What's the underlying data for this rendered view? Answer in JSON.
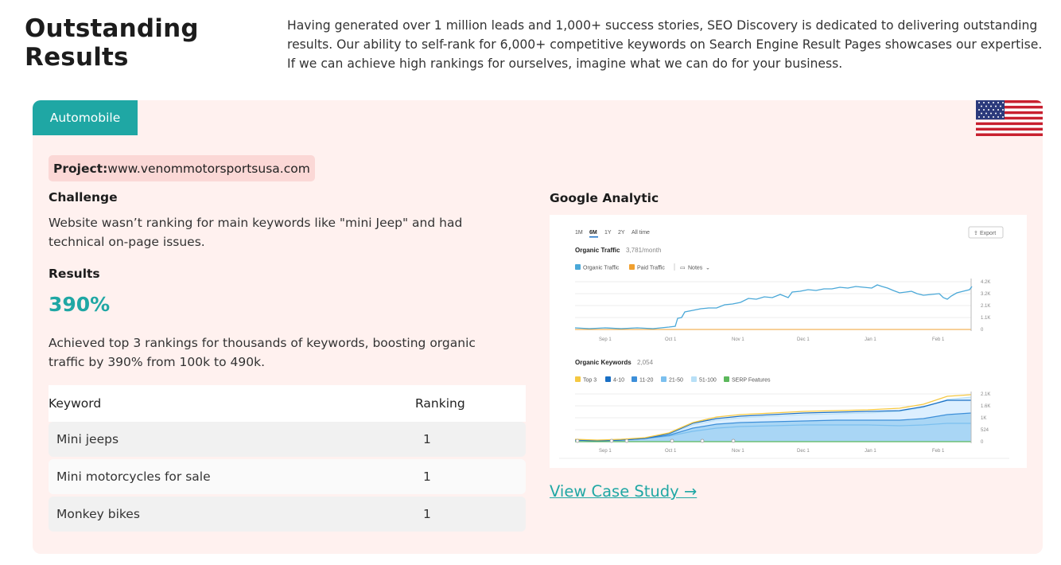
{
  "section": {
    "title_line1": "Outstanding",
    "title_line2": "Results",
    "intro": "Having generated over 1 million leads and 1,000+ success stories, SEO Discovery is dedicated to delivering outstanding results. Our ability to self-rank for 6,000+ competitive keywords on Search Engine Result Pages showcases our expertise. If we can achieve high rankings for ourselves, imagine what we can do for your business."
  },
  "card": {
    "tab_label": "Automobile",
    "flag_icon": "us-flag-icon",
    "project_label": "Project:",
    "project_url": "www.venommotorsportsusa.com",
    "challenge_title": "Challenge",
    "challenge_text": "Website wasn’t ranking for main keywords like \"mini Jeep\" and had technical on-page issues.",
    "results_title": "Results",
    "results_big": "390%",
    "results_text": "Achieved top 3 rankings for thousands of keywords, boosting organic traffic by 390% from 100k to 490k.",
    "table": {
      "headers": [
        "Keyword",
        "Ranking"
      ],
      "rows": [
        {
          "keyword": "Mini jeeps",
          "rank": "1"
        },
        {
          "keyword": "Mini motorcycles for sale",
          "rank": "1"
        },
        {
          "keyword": "Monkey bikes",
          "rank": "1"
        }
      ]
    },
    "ga_title": "Google Analytic",
    "case_study_link": "View Case Study →"
  },
  "analytics": {
    "ranges": [
      "1M",
      "6M",
      "1Y",
      "2Y",
      "All time"
    ],
    "selected_range": "6M",
    "export_label": "Export",
    "traffic_title": "Organic Traffic",
    "traffic_value": "3,781/month",
    "traffic_legend": [
      "Organic Traffic",
      "Paid Traffic",
      "Notes"
    ],
    "traffic_yticks": [
      "4.2K",
      "3.2K",
      "2.1K",
      "1.1K",
      "0"
    ],
    "keywords_title": "Organic Keywords",
    "keywords_value": "2,054",
    "keywords_legend": [
      "Top 3",
      "4-10",
      "11-20",
      "21-50",
      "51-100",
      "SERP Features"
    ],
    "keywords_yticks": [
      "2.1K",
      "1.6K",
      "1K",
      "524",
      "0"
    ],
    "xticks": [
      "Sep 1",
      "Oct 1",
      "Nov 1",
      "Dec 1",
      "Jan 1",
      "Feb 1"
    ],
    "colors": {
      "organic": "#4aa8d8",
      "paid": "#f0a030",
      "top3": "#f5c842",
      "k4_10": "#1a6fc4",
      "k11_20": "#3d8fd9",
      "k21_50": "#7cc0ef",
      "k51_100": "#b8e0f7",
      "serp": "#5cb85c"
    }
  }
}
